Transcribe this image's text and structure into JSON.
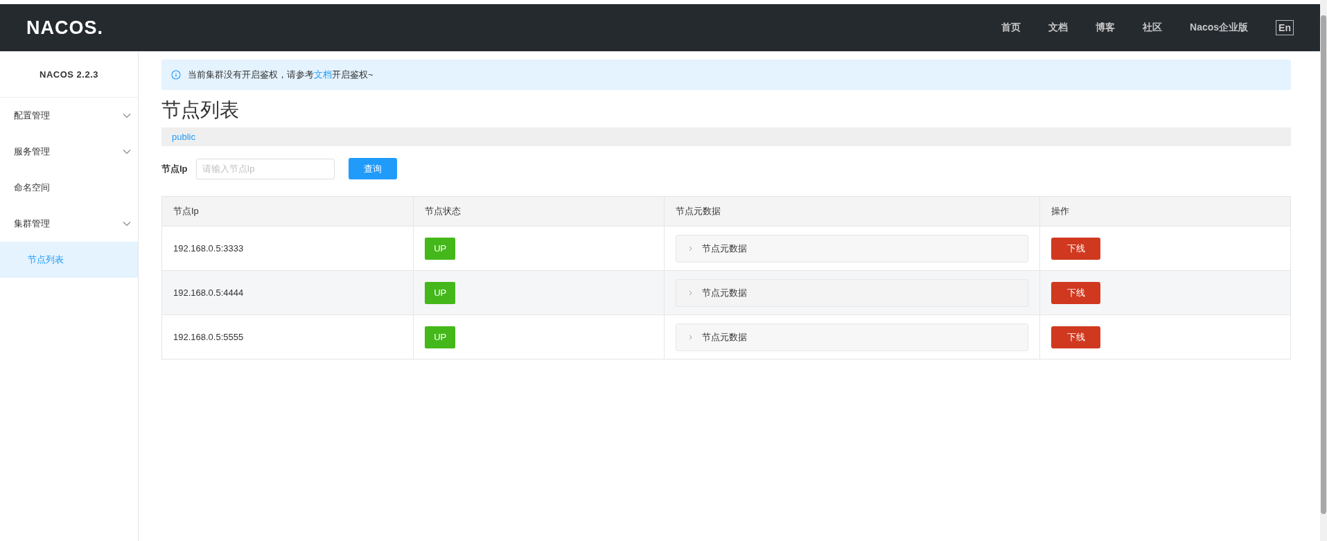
{
  "header": {
    "logo": "NACOS.",
    "nav": [
      "首页",
      "文档",
      "博客",
      "社区",
      "Nacos企业版"
    ],
    "language_button": "En"
  },
  "sidebar": {
    "version": "NACOS 2.2.3",
    "items": [
      {
        "label": "配置管理",
        "kind": "group",
        "selected": false
      },
      {
        "label": "服务管理",
        "kind": "group",
        "selected": false
      },
      {
        "label": "命名空间",
        "kind": "link",
        "selected": false
      },
      {
        "label": "集群管理",
        "kind": "group",
        "selected": false,
        "children": [
          {
            "label": "节点列表",
            "selected": true
          }
        ]
      }
    ]
  },
  "notice": {
    "text_before": "当前集群没有开启鉴权，请参考",
    "link": "文档",
    "text_after": "开启鉴权~"
  },
  "page_title": "节点列表",
  "namespace": "public",
  "search": {
    "label": "节点Ip",
    "placeholder": "请输入节点Ip",
    "button": "查询"
  },
  "table": {
    "columns": [
      "节点Ip",
      "节点状态",
      "节点元数据",
      "操作"
    ],
    "rows": [
      {
        "ip": "192.168.0.5:3333",
        "status": "UP",
        "metadata": "节点元数据",
        "action": "下线"
      },
      {
        "ip": "192.168.0.5:4444",
        "status": "UP",
        "metadata": "节点元数据",
        "action": "下线"
      },
      {
        "ip": "192.168.0.5:5555",
        "status": "UP",
        "metadata": "节点元数据",
        "action": "下线"
      }
    ]
  }
}
